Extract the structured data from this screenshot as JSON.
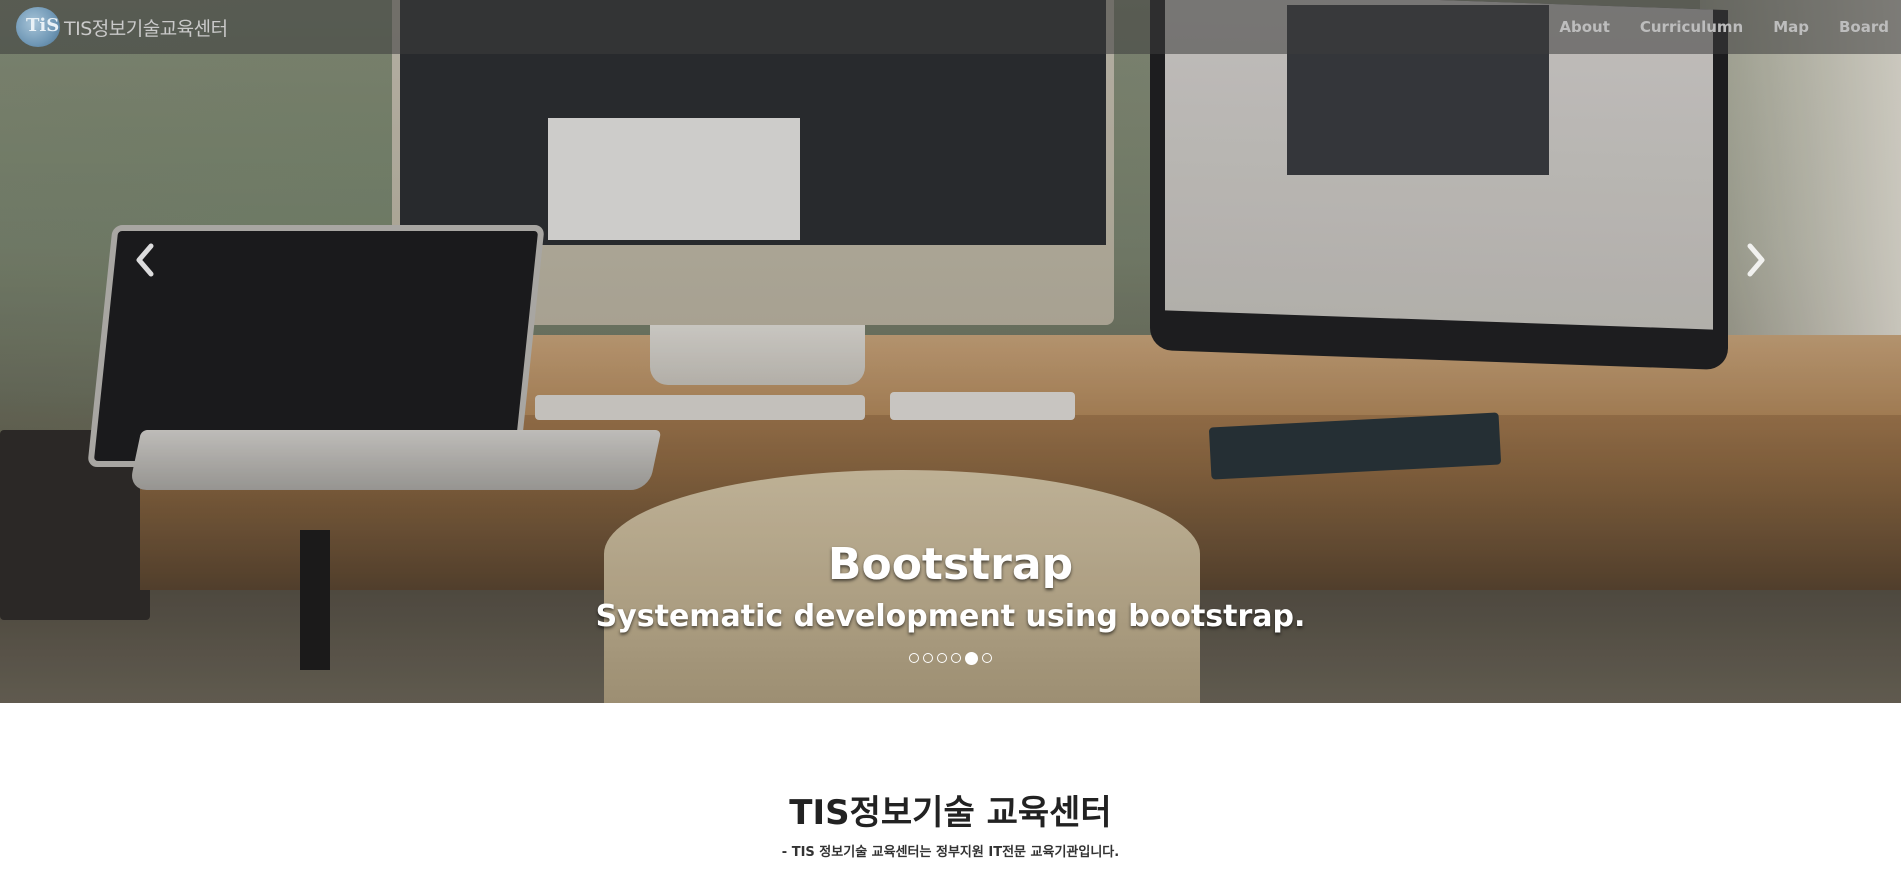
{
  "navbar": {
    "brand_text": "TIS정보기술교육센터",
    "brand_logo_mark": "TiS",
    "links": [
      {
        "label": "About"
      },
      {
        "label": "Curriculumn"
      },
      {
        "label": "Map"
      },
      {
        "label": "Board"
      }
    ]
  },
  "carousel": {
    "caption_title": "Bootstrap",
    "caption_subtitle": "Systematic development using bootstrap.",
    "slide_count": 6,
    "active_index": 4,
    "prev_icon": "chevron-left-icon",
    "next_icon": "chevron-right-icon"
  },
  "intro": {
    "title": "TIS정보기술 교육센터",
    "description": "- TIS 정보기술 교육센터는 정부지원 IT전문 교육기관입니다."
  },
  "colors": {
    "navbar_bg": "#3c3c3c",
    "text_dark": "#222222",
    "caption_text": "#ffffff"
  }
}
